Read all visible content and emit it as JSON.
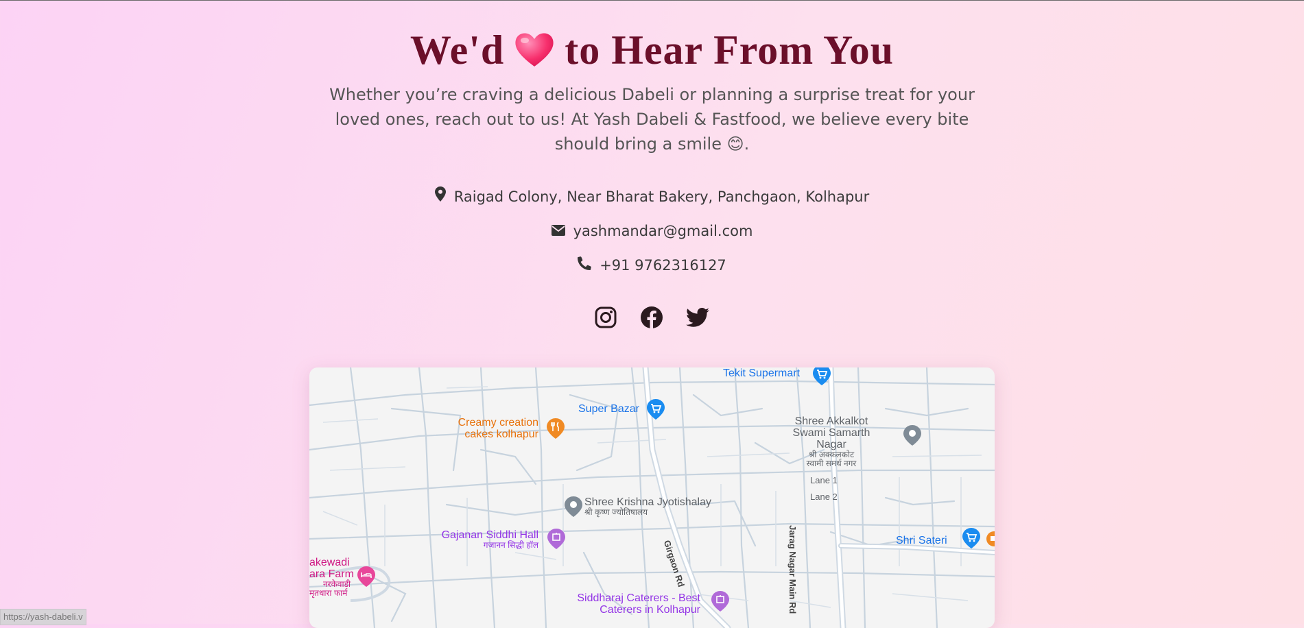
{
  "heading": {
    "before": "We'd",
    "after": "to Hear From You",
    "heart": "heart-emoji"
  },
  "intro": {
    "text": "Whether you’re craving a delicious Dabeli or planning a surprise treat for your loved ones, reach out to us! At Yash Dabeli & Fastfood, we believe every bite should bring a smile",
    "emoji": "😊",
    "end": "."
  },
  "contact": {
    "address": "Raigad Colony, Near Bharat Bakery, Panchgaon, Kolhapur",
    "email": "yashmandar@gmail.com",
    "phone": "+91 9762316127"
  },
  "social": [
    "instagram-icon",
    "facebook-icon",
    "twitter-icon"
  ],
  "map": {
    "places": {
      "tekit": "Tekit Supermart",
      "super_bazar": "Super Bazar",
      "creamy_1": "Creamy creation",
      "creamy_2": "cakes kolhapur",
      "akkalkot_1": "Shree Akkalkot",
      "akkalkot_2": "Swami Samarth Nagar",
      "akkalkot_3": "श्री अक्कलकोट",
      "akkalkot_4": "स्वामी समर्थ नगर",
      "krishna_1": "Shree Krishna Jyotishalay",
      "krishna_2": "श्री कृष्ण ज्योतिषालय",
      "gajanan_1": "Gajanan Siddhi Hall",
      "gajanan_2": "गजानन सिद्धी हॉल",
      "sateri": "Shri Sateri",
      "siddharaj_1": "Siddharaj Caterers - Best",
      "siddharaj_2": "Caterers in Kolhapur",
      "farm_1": "akewadi",
      "farm_2": "ara Farm",
      "farm_3": "नरकेवाडी",
      "farm_4": "मृतधारा फार्म"
    },
    "roads": {
      "lane1": "Lane 1",
      "lane2": "Lane 2",
      "jarag": "Jarag Nagar Main Rd",
      "girgaon": "Girgaon Rd"
    }
  },
  "status_url": "https://yash-dabeli.v"
}
